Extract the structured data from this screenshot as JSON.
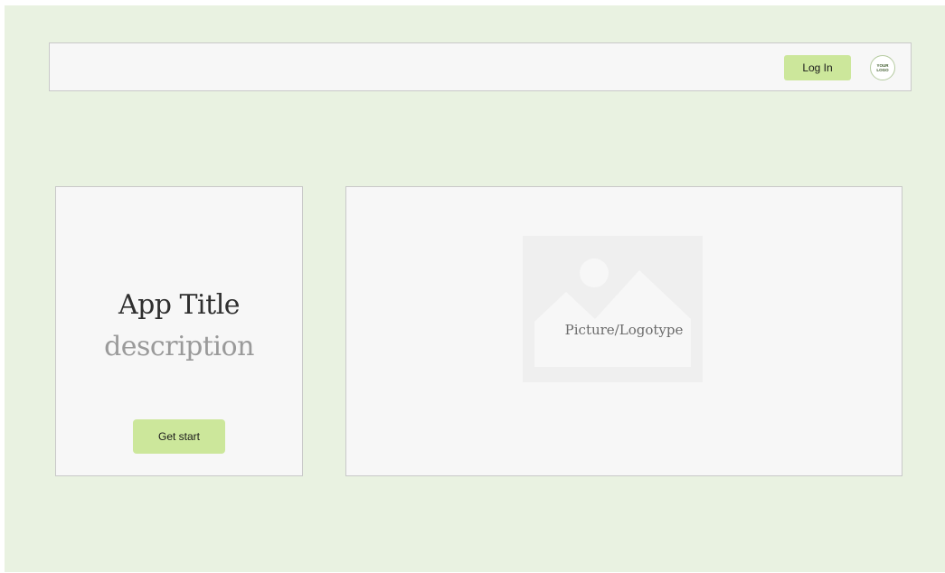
{
  "header": {
    "login_label": "Log In",
    "logo_text": "YOUR\nLOGO"
  },
  "hero": {
    "title": "App Title",
    "description": "description",
    "cta_label": "Get start"
  },
  "media": {
    "placeholder_label": "Picture/Logotype"
  },
  "colors": {
    "background": "#e9f2e1",
    "panel": "#f7f7f7",
    "accent": "#cce79b",
    "border": "#c9c9c9"
  },
  "icons": {
    "placeholder": "image-placeholder-icon",
    "logo": "logo-icon"
  }
}
